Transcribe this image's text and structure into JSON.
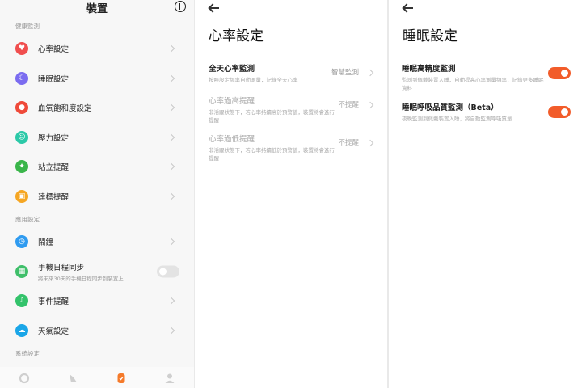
{
  "panel1": {
    "title": "裝置",
    "sections": {
      "health": "健康監測",
      "apps": "應用設定",
      "system": "系統設定"
    },
    "health_items": [
      {
        "label": "心率設定",
        "icon": "heart-icon",
        "color": "#f04e4e"
      },
      {
        "label": "睡眠設定",
        "icon": "moon-icon",
        "color": "#7b6cf0"
      },
      {
        "label": "血氧飽和度設定",
        "icon": "blood-drop-icon",
        "color": "#ef4a3a"
      },
      {
        "label": "壓力設定",
        "icon": "smile-icon",
        "color": "#2cc9a8"
      },
      {
        "label": "站立提醒",
        "icon": "person-standing-icon",
        "color": "#3ab54a"
      },
      {
        "label": "達標提醒",
        "icon": "goal-icon",
        "color": "#f5a623"
      }
    ],
    "app_items": [
      {
        "label": "鬧鐘",
        "icon": "alarm-icon",
        "color": "#2f9bf0"
      },
      {
        "label": "手機日程同步",
        "sub": "將未來30天的手機日程同步到裝置上",
        "icon": "calendar-icon",
        "color": "#3fbf6a"
      },
      {
        "label": "事件提醒",
        "icon": "bell-icon",
        "color": "#33c36b"
      },
      {
        "label": "天氣設定",
        "icon": "weather-icon",
        "color": "#1aa6e8"
      }
    ]
  },
  "panel2": {
    "title": "心率設定",
    "rows": [
      {
        "label": "全天心率監測",
        "desc": "按照設定頻率自動測量，記錄全天心率",
        "value": "智慧監測"
      },
      {
        "label": "心率過高提醒",
        "desc": "非活躍狀態下，若心率持續高於預警值，裝置將會進行提醒",
        "value": "不提醒"
      },
      {
        "label": "心率過低提醒",
        "desc": "非活躍狀態下，若心率持續低於預警值，裝置將會進行提醒",
        "value": "不提醒"
      }
    ]
  },
  "panel3": {
    "title": "睡眠設定",
    "rows": [
      {
        "label": "睡眠高精度監測",
        "desc": "監測到佩戴裝置入睡，自動提高心率測量頻率，記錄更多睡眠資料"
      },
      {
        "label": "睡眠呼吸品質監測（Beta）",
        "desc": "夜晚監測到佩戴裝置入睡，將自動監測呼吸質量"
      }
    ]
  },
  "colors": {
    "accent": "#f25c2a",
    "nav_active": "#f57a2a",
    "nav_inactive": "#cfcfcf"
  }
}
